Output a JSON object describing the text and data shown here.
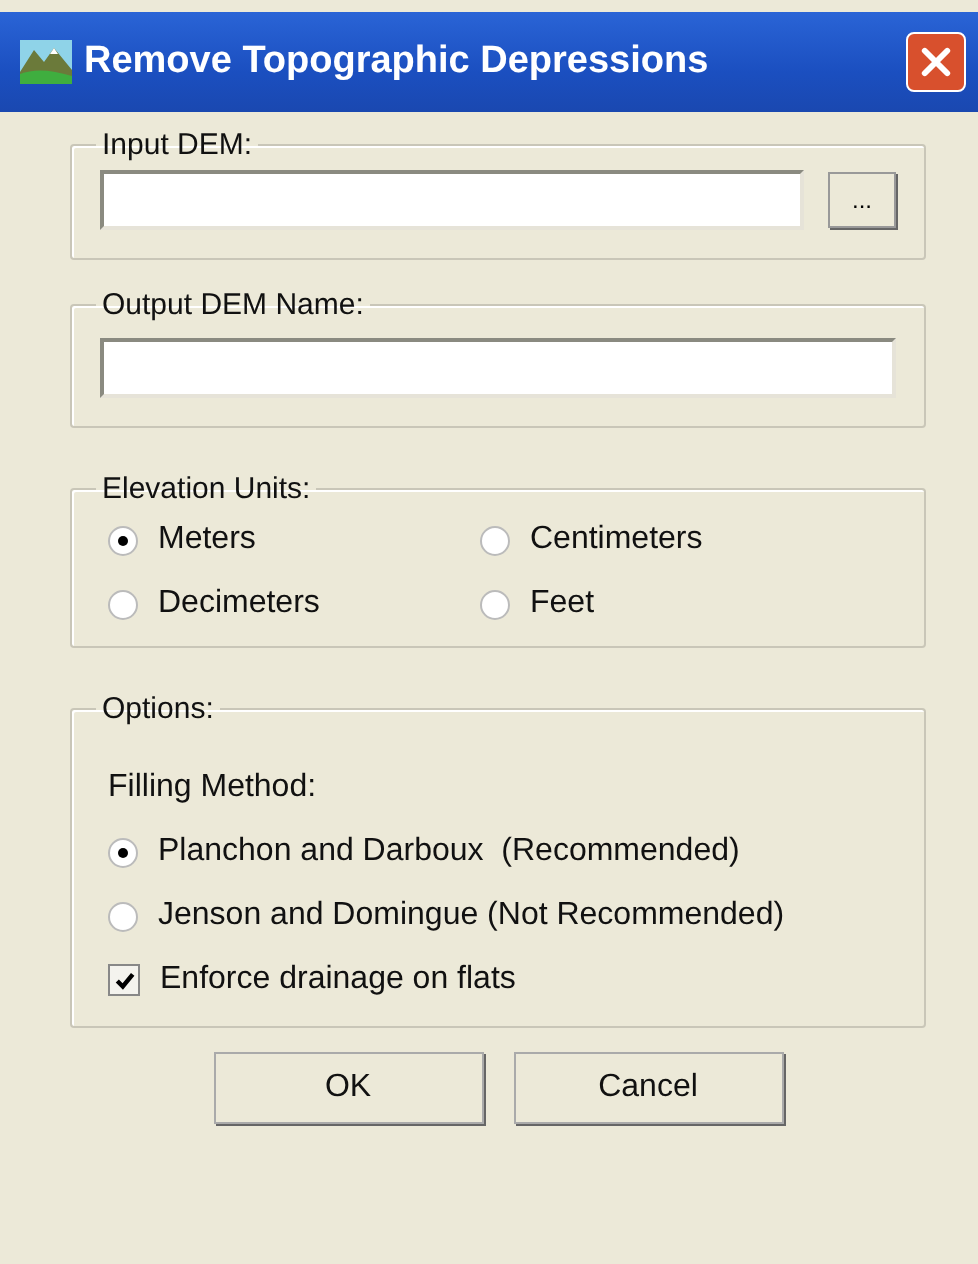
{
  "window": {
    "title": "Remove Topographic Depressions"
  },
  "input_dem": {
    "label": "Input DEM:",
    "browse_button": "..."
  },
  "output_dem": {
    "label": "Output DEM Name:"
  },
  "elevation_units": {
    "label": "Elevation Units:",
    "options": [
      {
        "label": "Meters",
        "selected": true
      },
      {
        "label": "Centimeters",
        "selected": false
      },
      {
        "label": "Decimeters",
        "selected": false
      },
      {
        "label": "Feet",
        "selected": false
      }
    ]
  },
  "options": {
    "label": "Options:",
    "filling_method": {
      "label": "Filling Method:",
      "options": [
        {
          "label": "Planchon and Darboux  (Recommended)",
          "selected": true
        },
        {
          "label": "Jenson and Domingue (Not Recommended)",
          "selected": false
        }
      ]
    },
    "enforce_drainage": {
      "label": "Enforce drainage on flats",
      "checked": true
    }
  },
  "buttons": [
    "OK",
    "Cancel"
  ]
}
